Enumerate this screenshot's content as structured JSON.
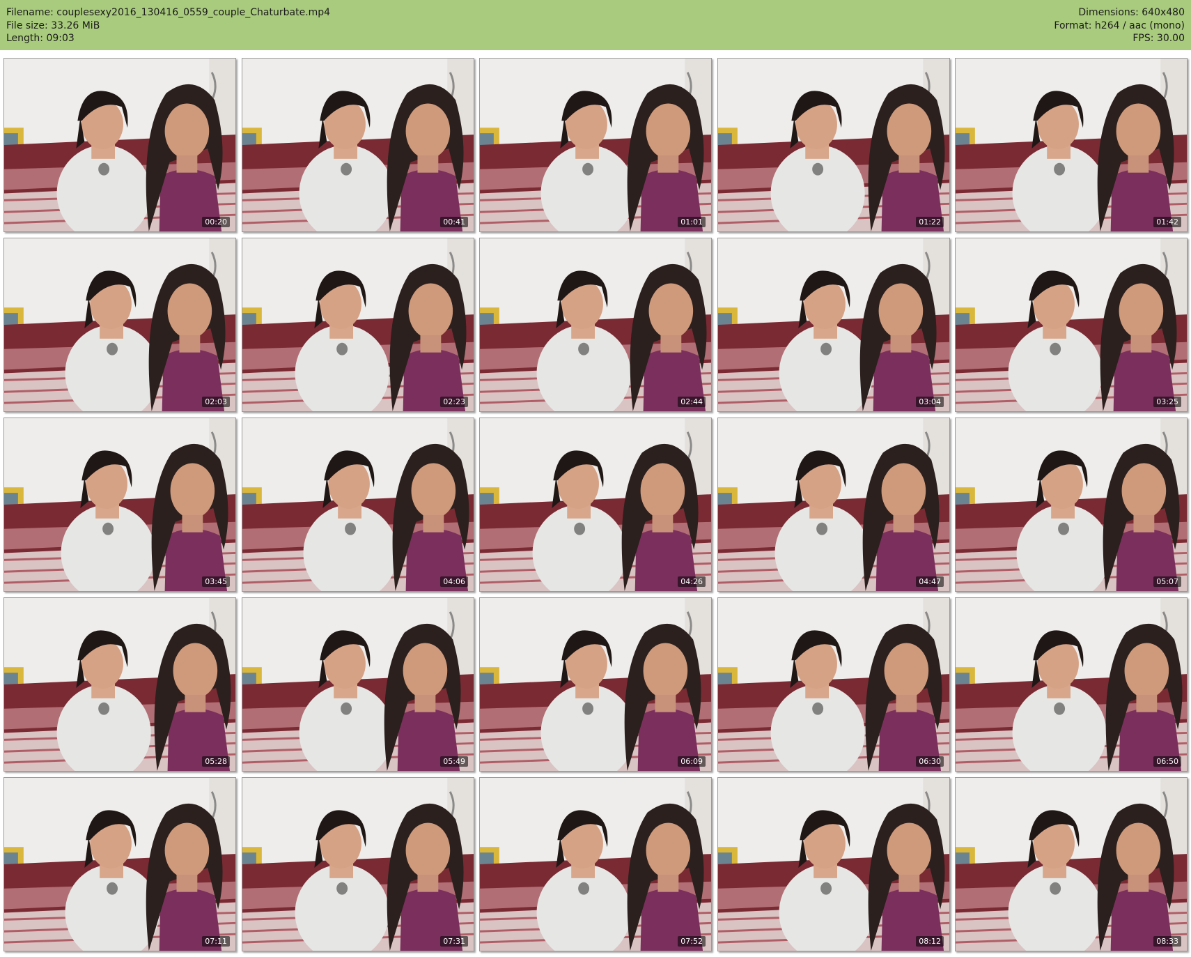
{
  "header": {
    "filename": "Filename: couplesexy2016_130416_0559_couple_Chaturbate.mp4",
    "filesize": "File size: 33.26 MiB",
    "length": "Length: 09:03",
    "dimensions": "Dimensions: 640x480",
    "format": "Format: h264 / aac (mono)",
    "fps": "FPS: 30.00"
  },
  "colors": {
    "header_bg": "#a9cb7d",
    "wall": "#efedeb",
    "bed_red": "#7a2a33",
    "white_shirt": "#e6e6e4",
    "purple_top": "#7b2f5d",
    "hair": "#1e1716"
  },
  "thumbnails": [
    {
      "time": "00:20"
    },
    {
      "time": "00:41"
    },
    {
      "time": "01:01"
    },
    {
      "time": "01:22"
    },
    {
      "time": "01:42"
    },
    {
      "time": "02:03"
    },
    {
      "time": "02:23"
    },
    {
      "time": "02:44"
    },
    {
      "time": "03:04"
    },
    {
      "time": "03:25"
    },
    {
      "time": "03:45"
    },
    {
      "time": "04:06"
    },
    {
      "time": "04:26"
    },
    {
      "time": "04:47"
    },
    {
      "time": "05:07"
    },
    {
      "time": "05:28"
    },
    {
      "time": "05:49"
    },
    {
      "time": "06:09"
    },
    {
      "time": "06:30"
    },
    {
      "time": "06:50"
    },
    {
      "time": "07:11"
    },
    {
      "time": "07:31"
    },
    {
      "time": "07:52"
    },
    {
      "time": "08:12"
    },
    {
      "time": "08:33"
    }
  ]
}
